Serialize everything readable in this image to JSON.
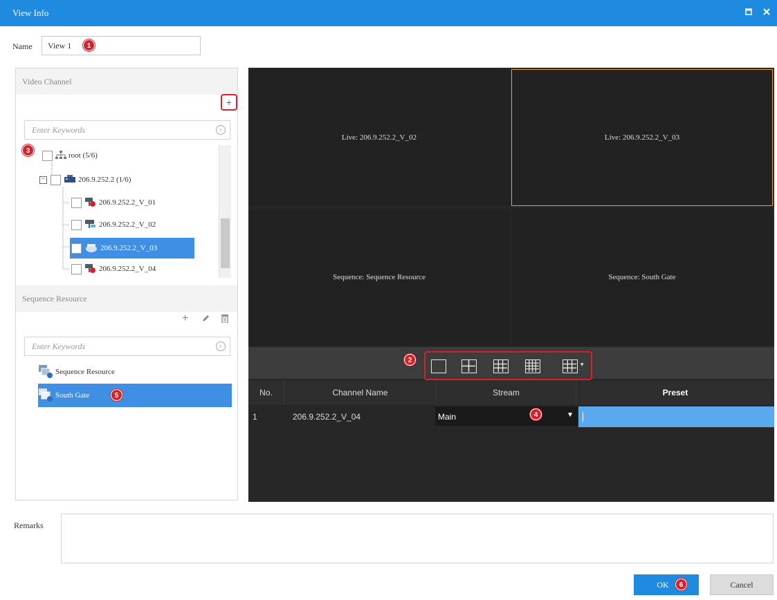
{
  "window": {
    "title": "View Info",
    "restore_icon": "restore-icon",
    "close_icon": "close-icon"
  },
  "name_field": {
    "label": "Name",
    "value": "View 1"
  },
  "badges": {
    "b1": "1",
    "b2": "2",
    "b3": "3",
    "b4": "4",
    "b5": "5",
    "b6": "6"
  },
  "video_channel": {
    "title": "Video Channel",
    "add_label": "+",
    "filter_placeholder": "Enter Keywords",
    "tree": {
      "root": "root (5/6)",
      "device": "206.9.252.2 (1/6)",
      "channels": [
        "206.9.252.2_V_01",
        "206.9.252.2_V_02",
        "206.9.252.2_V_03",
        "206.9.252.2_V_04"
      ]
    }
  },
  "sequence_resource": {
    "title": "Sequence Resource",
    "filter_placeholder": "Enter Keywords",
    "items": [
      "Sequence Resource",
      "South Gate"
    ]
  },
  "preview": {
    "cells": [
      "Live: 206.9.252.2_V_02",
      "Live: 206.9.252.2_V_03",
      "Sequence: Sequence Resource",
      "Sequence: South Gate"
    ]
  },
  "table": {
    "headers": [
      "No.",
      "Channel Name",
      "Stream",
      "Preset"
    ],
    "rows": [
      {
        "no": "1",
        "channel": "206.9.252.2_V_04",
        "stream": "Main",
        "preset": ""
      }
    ]
  },
  "remarks": {
    "label": "Remarks",
    "value": ""
  },
  "buttons": {
    "ok": "OK",
    "cancel": "Cancel"
  },
  "colors": {
    "accent": "#1e8be0",
    "badge": "#d9202a",
    "selection": "#e89f3c",
    "preview_bg": "#272727"
  }
}
